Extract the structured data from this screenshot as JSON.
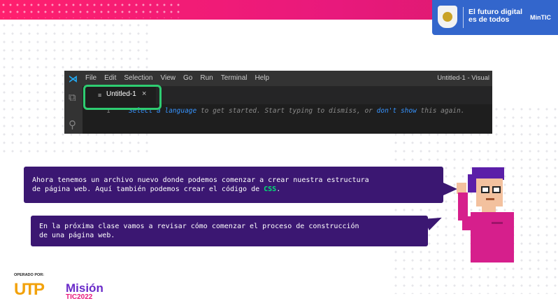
{
  "gov_banner": {
    "slogan": "El futuro digital es de todos",
    "ministry": "MinTIC"
  },
  "vscode": {
    "logo_icon": "vscode-logo-icon",
    "menu": [
      "File",
      "Edit",
      "Selection",
      "View",
      "Go",
      "Run",
      "Terminal",
      "Help"
    ],
    "window_title": "Untitled-1 - Visual",
    "tab": {
      "icon": "≡",
      "label": "Untitled-1",
      "close": "×"
    },
    "editor": {
      "line_number": "1",
      "link1": "Select a language",
      "text1": " to get started. Start typing to dismiss, or ",
      "link2": "don't show",
      "text2": " this again."
    }
  },
  "slide": {
    "bubble1_line1": "Ahora tenemos un archivo nuevo donde podemos comenzar a crear nuestra estructura",
    "bubble1_line2_pre": "de página web. Aquí también podemos crear el código de ",
    "bubble1_highlight": "CSS",
    "bubble1_line2_post": ".",
    "bubble2_line1": "En la próxima clase vamos a revisar cómo comenzar el proceso de construcción",
    "bubble2_line2": "de una página web."
  },
  "footer": {
    "operated_by": "OPERADO POR:",
    "utp": "UTP",
    "mision": "Misión",
    "tic": "TIC2022"
  },
  "colors": {
    "accent_pink": "#e8197c",
    "bubble_purple": "#3b1772",
    "highlight_green": "#2ecc71",
    "gov_blue": "#3366cc"
  }
}
